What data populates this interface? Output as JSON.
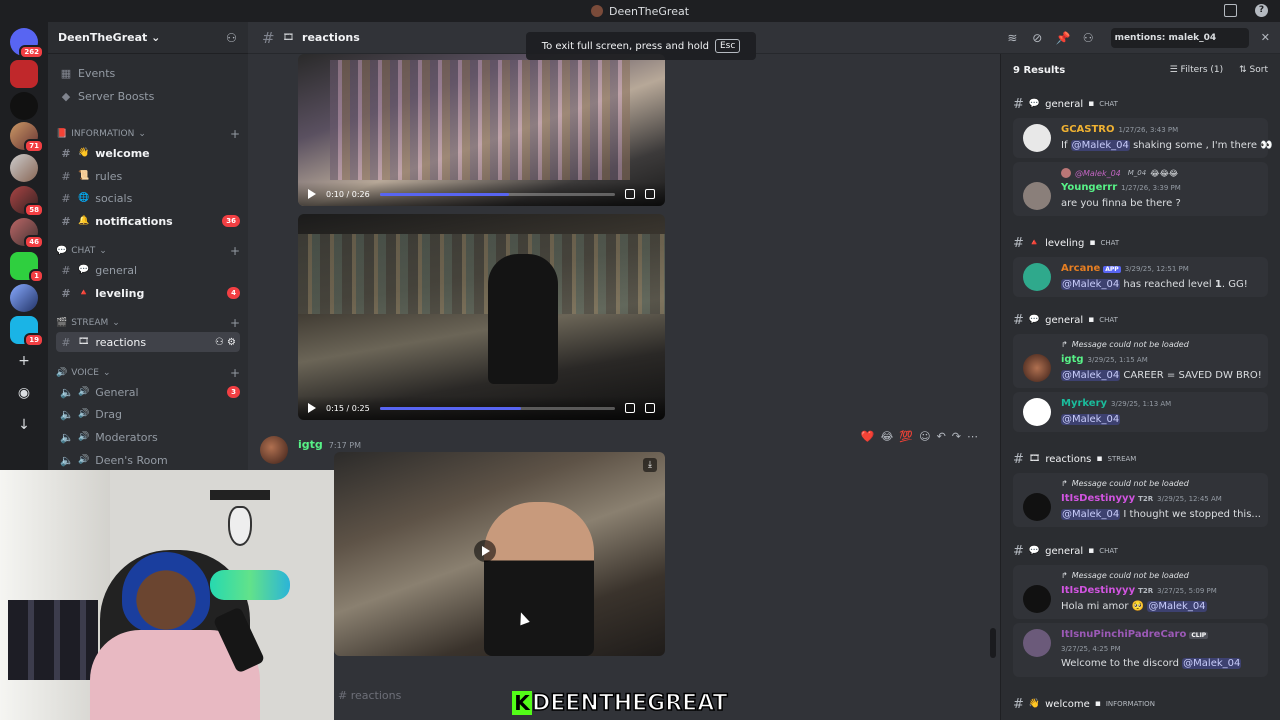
{
  "window": {
    "title": "DeenTheGreat"
  },
  "rail": {
    "badges": [
      "262",
      "71",
      "58",
      "46",
      "1",
      "19"
    ]
  },
  "guild": {
    "name": "DeenTheGreat ⌄"
  },
  "sidebar": {
    "top_items": [
      "Events",
      "Server Boosts"
    ],
    "categories": {
      "information": "INFORMATION",
      "chat": "CHAT",
      "stream": "STREAM",
      "voice": "VOICE"
    },
    "channels": {
      "welcome": "welcome",
      "rules": "rules",
      "socials": "socials",
      "notifications": "notifications",
      "notifications_badge": "36",
      "general": "general",
      "leveling": "leveling",
      "leveling_badge": "4",
      "reactions": "reactions",
      "voice_general": "General",
      "voice_general_badge": "3",
      "drag": "Drag",
      "moderators": "Moderators",
      "deens_room": "Deen's Room"
    }
  },
  "header": {
    "channel": "reactions",
    "toast_text": "To exit full screen, press and hold",
    "toast_key": "Esc"
  },
  "videos": [
    {
      "time": "0:10 / 0:26",
      "progress": 0.55
    },
    {
      "time": "0:15 / 0:25",
      "progress": 0.6
    }
  ],
  "message": {
    "author": "igtg",
    "time": "7:17 PM"
  },
  "composer": {
    "placeholder": "# reactions"
  },
  "brand": {
    "k": "K",
    "text": "DEENTHEGREAT"
  },
  "search": {
    "query": "mentions: malek_04",
    "results_count": "9 Results",
    "filters_label": "Filters (1)",
    "sort_label": "Sort",
    "groups": [
      {
        "channel": "general",
        "category": "CHAT"
      },
      {
        "channel": "leveling",
        "category": "CHAT"
      },
      {
        "channel": "general",
        "category": "CHAT"
      },
      {
        "channel": "reactions",
        "category": "STREAM"
      },
      {
        "channel": "general",
        "category": "CHAT"
      },
      {
        "channel": "welcome",
        "category": "INFORMATION"
      }
    ],
    "results": {
      "r1": {
        "author": "GCASTRO",
        "time": "1/27/26, 3:43 PM",
        "pre": "If",
        "mention": "@Malek_04",
        "post": "shaking some , I'm there 👀"
      },
      "r2": {
        "reply_author": "@Malek_04",
        "reply_role": "M_04",
        "reply_emoji": "😂😂😂",
        "author": "Youngerrr",
        "time": "1/27/26, 3:39 PM",
        "text": "are you finna be there ?"
      },
      "r3": {
        "author": "Arcane",
        "tag": "APP",
        "time": "3/29/25, 12:51 PM",
        "mention": "@Malek_04",
        "post": "has reached level",
        "level": "1",
        "post2": ". GG!"
      },
      "r4": {
        "reply": "Message could not be loaded",
        "author": "igtg",
        "time": "3/29/25, 1:15 AM",
        "mention": "@Malek_04",
        "post": "CAREER = SAVED DW BRO!"
      },
      "r5": {
        "author": "Myrkery",
        "time": "3/29/25, 1:13 AM",
        "mention": "@Malek_04"
      },
      "r6": {
        "reply": "Message could not be loaded",
        "author": "ItIsDestinyyy",
        "role": "T2R",
        "time": "3/29/25, 12:45 AM",
        "mention": "@Malek_04",
        "post": "I thought we stopped this..."
      },
      "r7": {
        "reply": "Message could not be loaded",
        "author": "ItIsDestinyyy",
        "role": "T2R",
        "time": "3/27/25, 5:09 PM",
        "pre": "Hola mi amor 🥺",
        "mention": "@Malek_04"
      },
      "r8": {
        "author": "ItIsnuPinchiPadreCaro",
        "tag": "CLIP",
        "time": "3/27/25, 4:25 PM",
        "pre": "Welcome to the discord",
        "mention": "@Malek_04"
      }
    }
  },
  "colors": {
    "accent": "#5865f2",
    "badge": "#f23f43",
    "kick_green": "#53fc18"
  }
}
